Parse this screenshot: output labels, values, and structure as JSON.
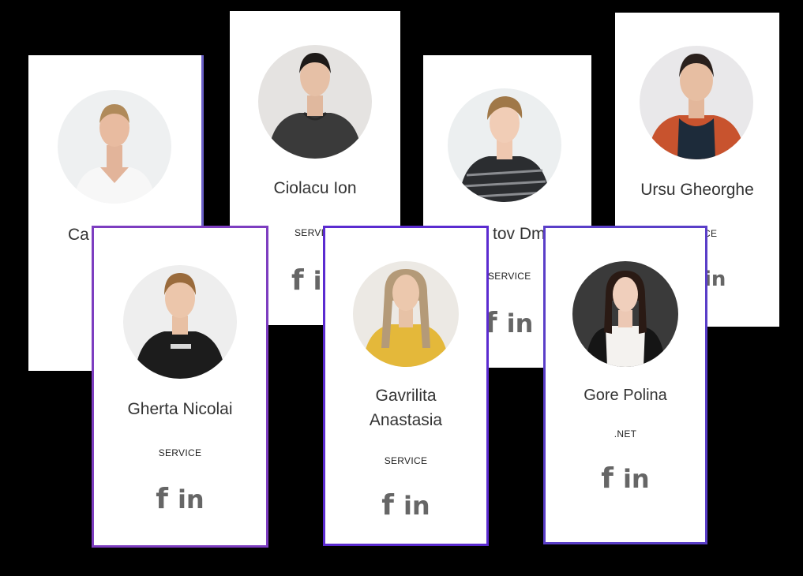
{
  "cards": [
    {
      "name": "Ca",
      "role": ""
    },
    {
      "name": "Ciolacu Ion",
      "role": "SERVI"
    },
    {
      "name": "tov Dmi",
      "role": "SERVICE"
    },
    {
      "name": "Ursu Gheorghe",
      "role": "CE"
    },
    {
      "name": "Gherta Nicolai",
      "role": "SERVICE"
    },
    {
      "name_line1": "Gavrilita",
      "name_line2": "Anastasia",
      "role": "SERVICE"
    },
    {
      "name": "Gore Polina",
      "role": ".NET"
    }
  ],
  "social": {
    "facebook_glyph": "f",
    "linkedin_glyph": "in"
  },
  "icons": {
    "facebook": "facebook-icon",
    "linkedin": "linkedin-icon",
    "avatar": "person-photo"
  },
  "colors": {
    "background": "#000000",
    "card": "#ffffff",
    "frame": "#7d3dc0",
    "text": "#333333",
    "icon": "#666666"
  }
}
